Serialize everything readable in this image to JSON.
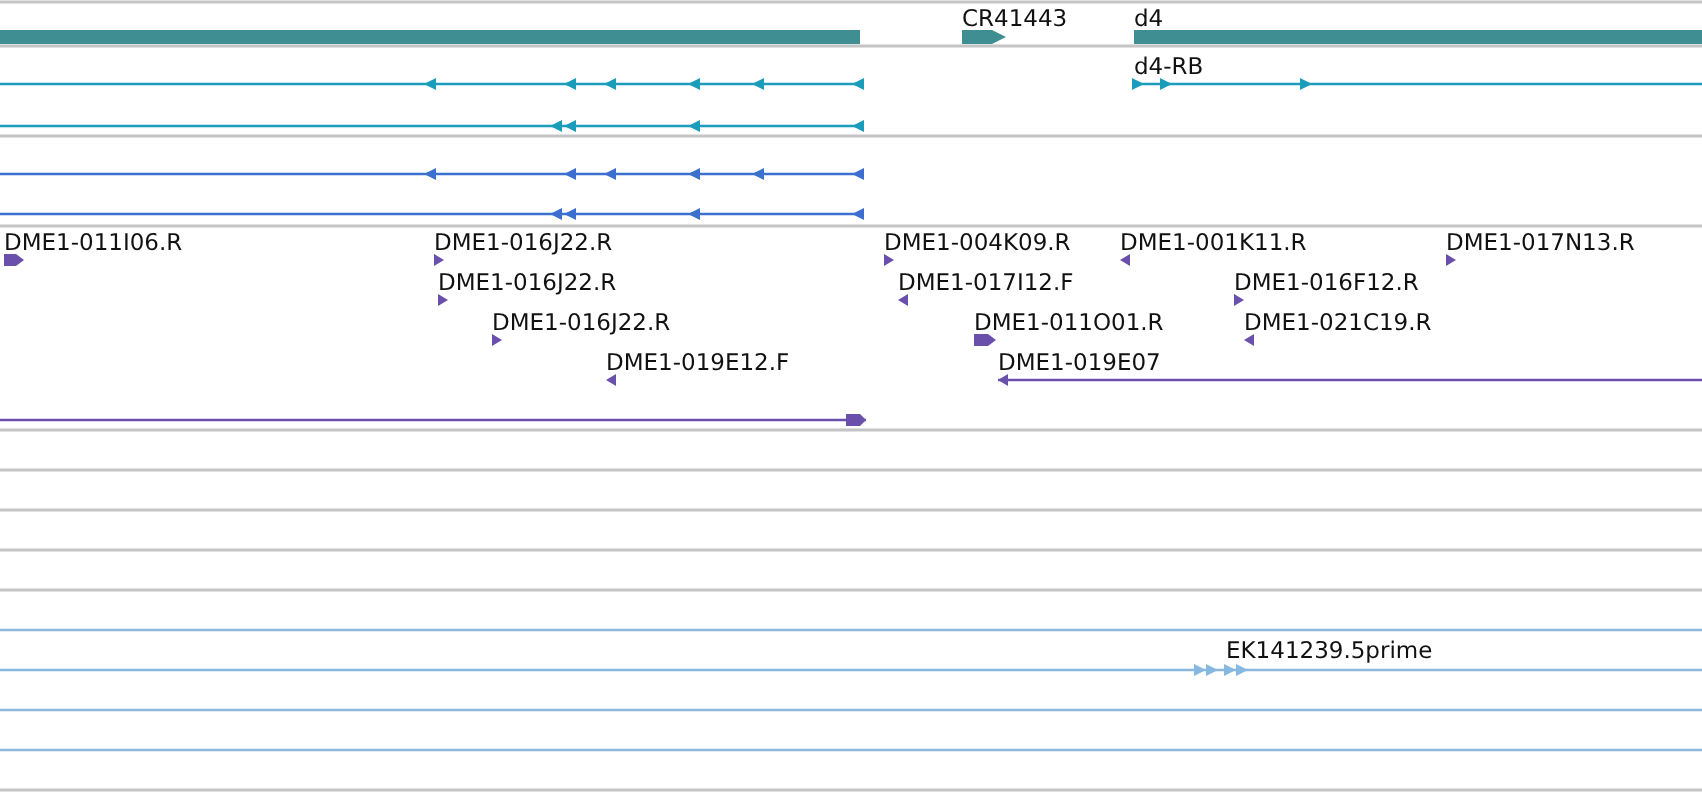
{
  "gene_track": {
    "genes": [
      {
        "kind": "block"
      },
      {
        "kind": "arrow",
        "label": "CR41443",
        "reverse": false
      },
      {
        "kind": "block",
        "label": "d4"
      }
    ]
  },
  "transcript_tracks": [
    {
      "color": "#1a9dba",
      "transcripts": [
        {
          "reverse": true
        },
        {
          "reverse": false,
          "label": "d4-RB"
        },
        {
          "reverse": true
        }
      ]
    },
    {
      "color": "#3b6fd0",
      "transcripts": [
        {
          "reverse": true
        },
        {
          "reverse": true
        }
      ]
    }
  ],
  "est_track": {
    "color": "#6a50aa",
    "features": [
      {
        "label": "DME1-011I06.R",
        "reverse": false
      },
      {
        "label": "DME1-016J22.R",
        "reverse": false
      },
      {
        "label": "DME1-016J22.R",
        "reverse": false
      },
      {
        "label": "DME1-016J22.R",
        "reverse": false
      },
      {
        "label": "DME1-019E12.F",
        "reverse": true
      },
      {
        "label": "DME1-004K09.R",
        "reverse": false
      },
      {
        "label": "DME1-017I12.F",
        "reverse": true
      },
      {
        "label": "DME1-011O01.R",
        "reverse": false
      },
      {
        "label": "DME1-019E07",
        "reverse": true
      },
      {
        "label": "DME1-001K11.R",
        "reverse": true
      },
      {
        "label": "DME1-016F12.R",
        "reverse": false
      },
      {
        "label": "DME1-021C19.R",
        "reverse": true
      },
      {
        "label": "DME1-017N13.R",
        "reverse": false
      },
      {
        "reverse": false
      }
    ]
  },
  "cdna_track": {
    "color": "#86b8e2",
    "features": [
      {
        "label": "EK141239.5prime",
        "reverse": false
      }
    ]
  }
}
